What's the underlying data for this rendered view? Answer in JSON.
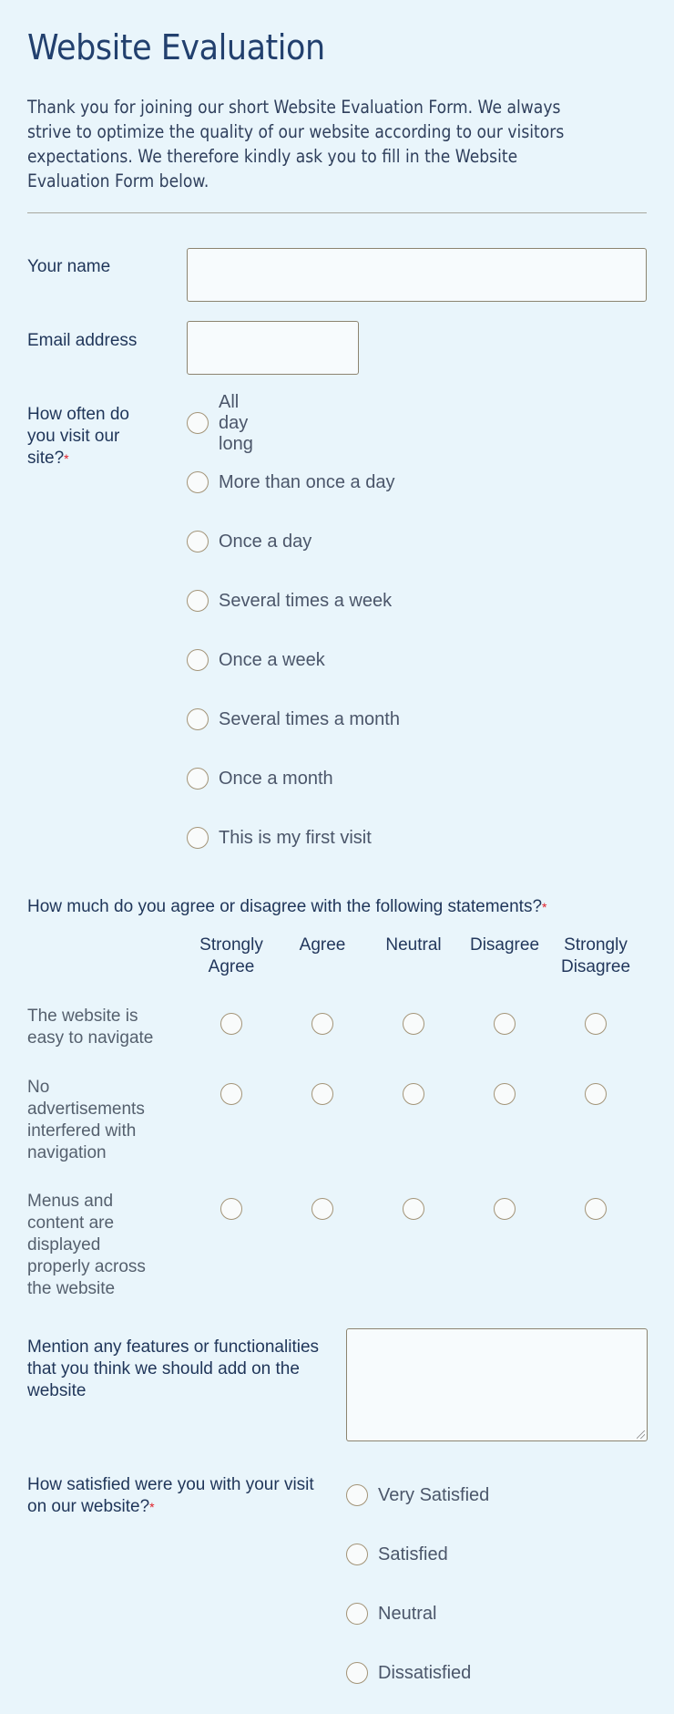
{
  "header": {
    "title": "Website Evaluation",
    "intro": "Thank you for joining our short Website Evaluation Form. We always strive to optimize the quality of our website according to our visitors expectations. We therefore kindly ask you to fill in the Website Evaluation Form below."
  },
  "fields": {
    "name": {
      "label": "Your name",
      "value": ""
    },
    "email": {
      "label": "Email address",
      "value": ""
    }
  },
  "visit_frequency": {
    "label": "How often do you visit our site?",
    "required_mark": "*",
    "options": [
      {
        "label": "All day long",
        "selected": false
      },
      {
        "label": "More than once a day",
        "selected": false
      },
      {
        "label": "Once a day",
        "selected": false
      },
      {
        "label": "Several times a week",
        "selected": false
      },
      {
        "label": "Once a week",
        "selected": false
      },
      {
        "label": "Several times a month",
        "selected": false
      },
      {
        "label": "Once a month",
        "selected": false
      },
      {
        "label": "This is my first visit",
        "selected": false
      }
    ]
  },
  "agreement_matrix": {
    "label": "How much do you agree or disagree with the following statements?",
    "required_mark": "*",
    "columns": [
      "Strongly Agree",
      "Agree",
      "Neutral",
      "Disagree",
      "Strongly Disagree"
    ],
    "rows": [
      {
        "label": "The website is easy to navigate",
        "selected": null
      },
      {
        "label": "No advertisements interfered with navigation",
        "selected": null
      },
      {
        "label": "Menus and content are displayed properly across the website",
        "selected": null
      }
    ]
  },
  "features": {
    "label": "Mention any features or functionalities that you think we should add on the website",
    "value": ""
  },
  "satisfaction": {
    "label": "How satisfied were you with your visit on our website?",
    "required_mark": "*",
    "options": [
      {
        "label": "Very Satisfied",
        "selected": false
      },
      {
        "label": "Satisfied",
        "selected": false
      },
      {
        "label": "Neutral",
        "selected": false
      },
      {
        "label": "Dissatisfied",
        "selected": false
      }
    ]
  }
}
